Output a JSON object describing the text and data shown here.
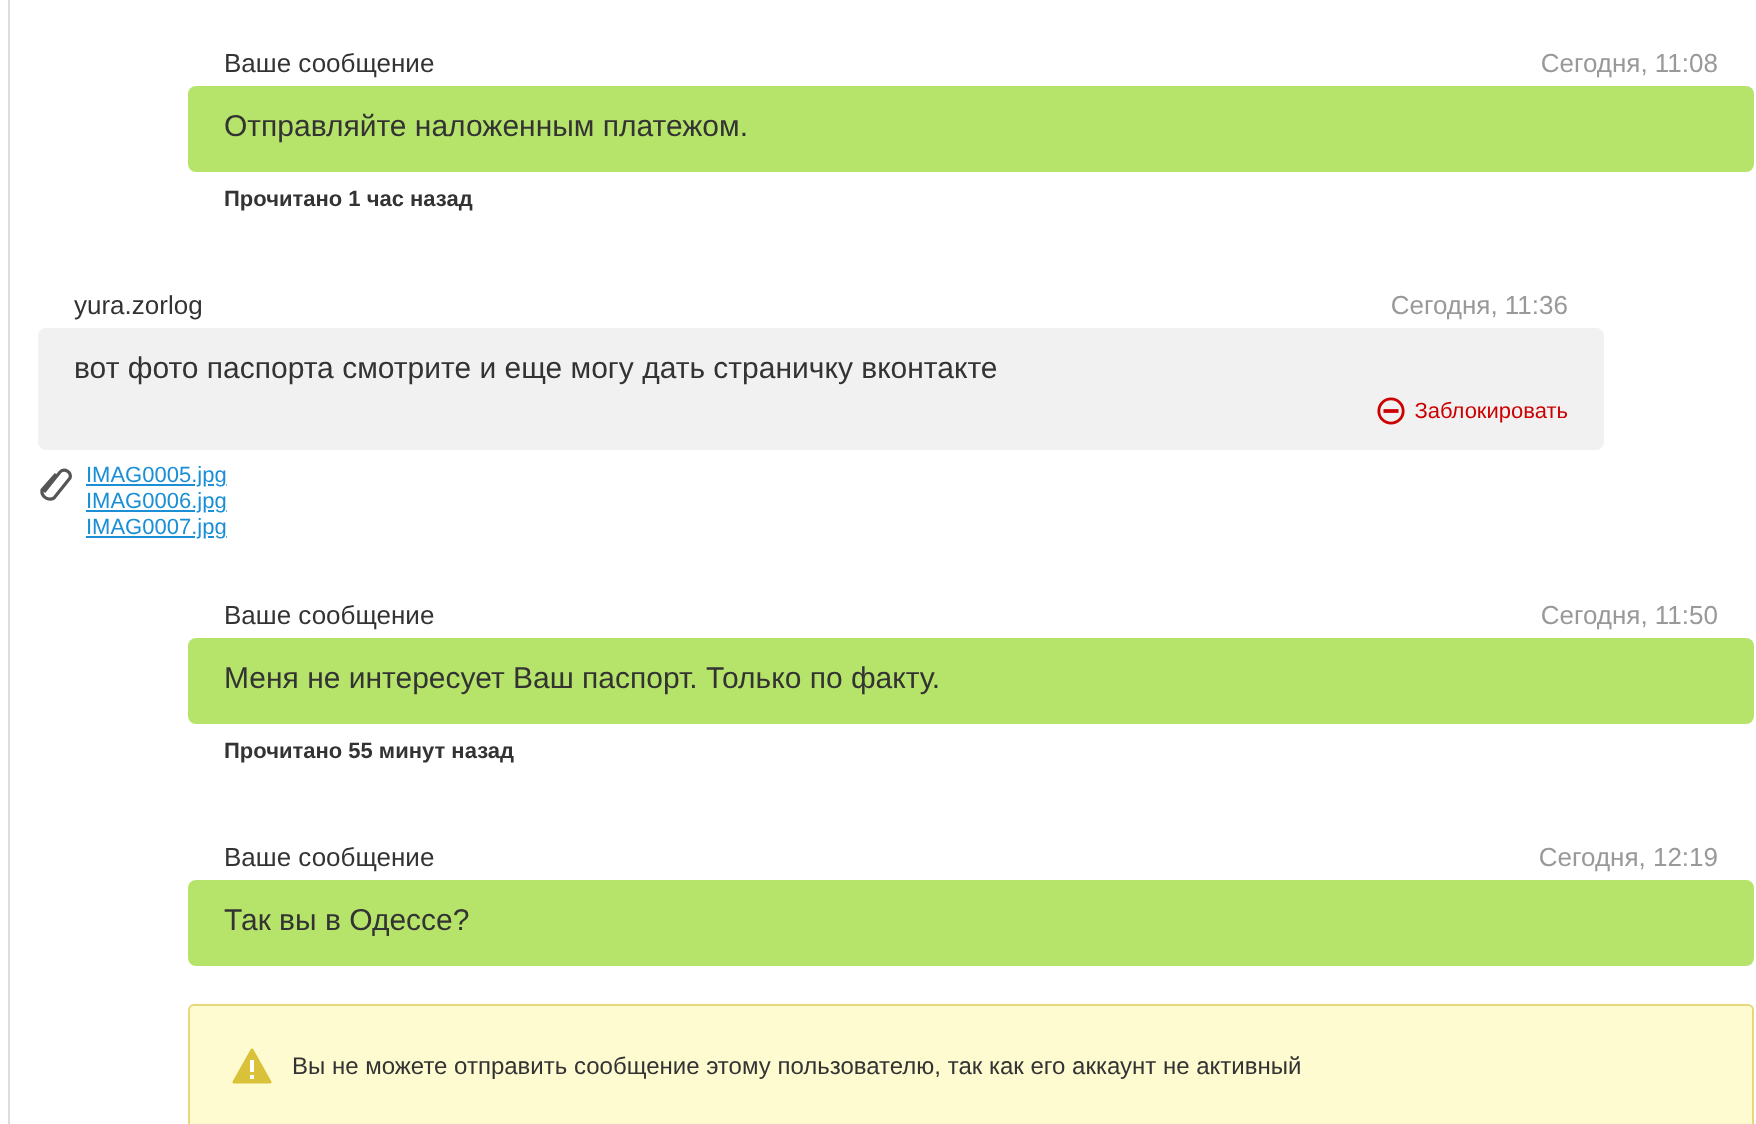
{
  "messages": [
    {
      "kind": "outgoing",
      "author": "Ваше сообщение",
      "time": "Сегодня, 11:08",
      "text": "Отправляйте наложенным платежом.",
      "read_status": "Прочитано 1 час назад"
    },
    {
      "kind": "incoming",
      "author": "yura.zorlog",
      "time": "Сегодня, 11:36",
      "text": "вот фото паспорта смотрите и еще могу дать страничку вконтакте",
      "block_label": "Заблокировать",
      "attachments": [
        "IMAG0005.jpg",
        "IMAG0006.jpg",
        "IMAG0007.jpg"
      ]
    },
    {
      "kind": "outgoing",
      "author": "Ваше сообщение",
      "time": "Сегодня, 11:50",
      "text": "Меня не интересует Ваш паспорт. Только по факту.",
      "read_status": "Прочитано 55 минут назад"
    },
    {
      "kind": "outgoing",
      "author": "Ваше сообщение",
      "time": "Сегодня, 12:19",
      "text": "Так вы в Одессе?"
    }
  ],
  "notice": {
    "text": "Вы не можете отправить сообщение этому пользователю, так как его аккаунт не активный"
  }
}
